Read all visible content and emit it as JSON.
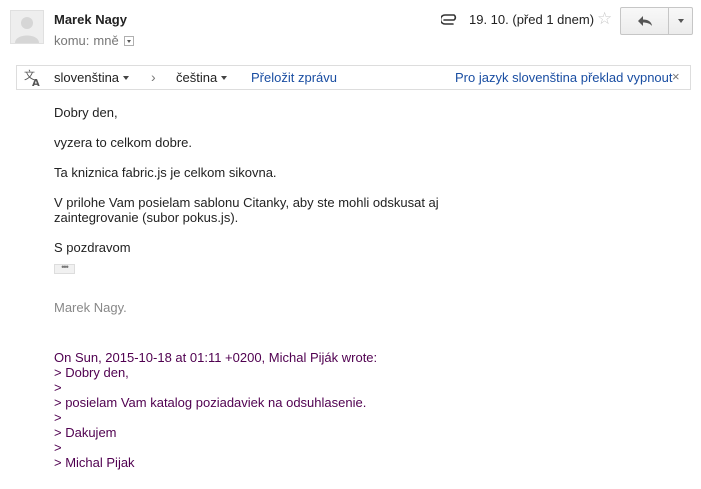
{
  "header": {
    "sender_name": "Marek Nagy",
    "recipient_prefix": "komu:",
    "recipient": "mně",
    "date": "19. 10. (před 1 dnem)"
  },
  "icons": {
    "avatar": "person-silhouette-icon",
    "attachment": "paperclip-icon",
    "star": "star-outline-icon",
    "reply": "reply-arrow-icon",
    "more": "chevron-down-icon",
    "translate": "translate-icon",
    "close": "close-icon"
  },
  "translate_bar": {
    "source_language": "slovenština",
    "arrow": "›",
    "target_language": "čeština",
    "translate_link": "Přeložit zprávu",
    "disable_link": "Pro jazyk slovenština překlad vypnout",
    "close": "×"
  },
  "body": {
    "lines": [
      "Dobry den,",
      "vyzera to celkom dobre.",
      "Ta kniznica fabric.js je celkom sikovna.",
      "V prilohe Vam posielam sablonu Citanky, aby ste mohli odskusat aj",
      "zaintegrovanie (subor pokus.js).",
      "S pozdravom"
    ],
    "ellipsis": "•••",
    "signature": "Marek Nagy."
  },
  "quote": {
    "header": "On Sun, 2015-10-18 at 01:11 +0200, Michal Piják wrote:",
    "lines": [
      "> Dobry den,",
      ">",
      "> posielam Vam katalog poziadaviek na odsuhlasenie.",
      ">",
      "> Dakujem",
      ">",
      "> Michal Pijak"
    ]
  },
  "colors": {
    "link": "#1a4ea2",
    "quote": "#500050",
    "signature": "#888888"
  }
}
